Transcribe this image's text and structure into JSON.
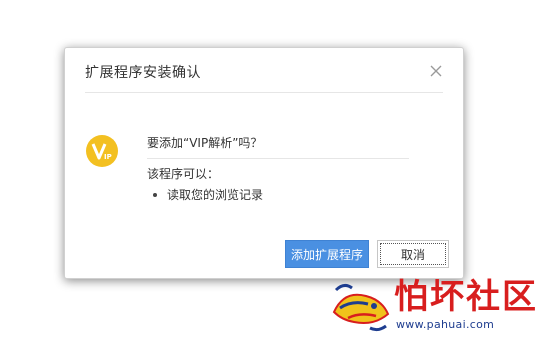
{
  "dialog": {
    "title": "扩展程序安装确认",
    "close_icon": "close-icon",
    "question": "要添加“VIP解析”吗？",
    "permissions_intro": "该程序可以：",
    "permissions": [
      "读取您的浏览记录"
    ],
    "extension_icon": "vip-extension-icon",
    "primary_button_label": "添加扩展程序",
    "cancel_button_label": "取消"
  },
  "watermark": {
    "title": "怕坏社区",
    "url": "www.pahuai.com"
  },
  "colors": {
    "primary_button": "#4a90e2",
    "extension_icon_bg": "#f3c021",
    "watermark_red": "#d81e1e",
    "watermark_blue": "#1e3d8f"
  }
}
